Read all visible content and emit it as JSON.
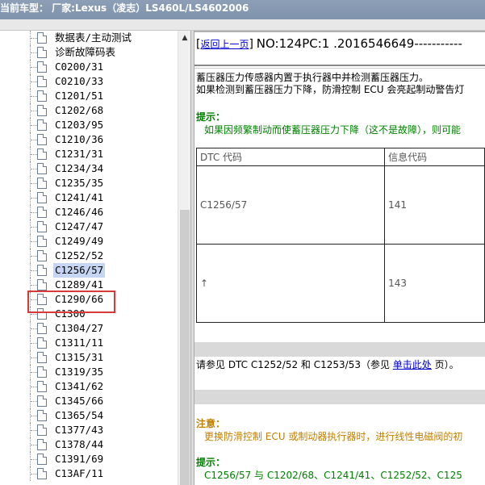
{
  "window": {
    "title": "当前车型：  厂家:Lexus（凌志）LS460L/LS4602006"
  },
  "tree": {
    "items": [
      {
        "label": "数据表/主动测试"
      },
      {
        "label": "诊断故障码表"
      },
      {
        "label": "C0200/31"
      },
      {
        "label": "C0210/33"
      },
      {
        "label": "C1201/51"
      },
      {
        "label": "C1202/68"
      },
      {
        "label": "C1203/95"
      },
      {
        "label": "C1210/36"
      },
      {
        "label": "C1231/31"
      },
      {
        "label": "C1234/34"
      },
      {
        "label": "C1235/35"
      },
      {
        "label": "C1241/41"
      },
      {
        "label": "C1246/46"
      },
      {
        "label": "C1247/47"
      },
      {
        "label": "C1249/49"
      },
      {
        "label": "C1252/52"
      },
      {
        "label": "C1256/57"
      },
      {
        "label": "C1289/41"
      },
      {
        "label": "C1290/66"
      },
      {
        "label": "C1300"
      },
      {
        "label": "C1304/27"
      },
      {
        "label": "C1311/11"
      },
      {
        "label": "C1315/31"
      },
      {
        "label": "C1319/35"
      },
      {
        "label": "C1341/62"
      },
      {
        "label": "C1345/66"
      },
      {
        "label": "C1365/54"
      },
      {
        "label": "C1377/43"
      },
      {
        "label": "C1378/44"
      },
      {
        "label": "C1391/69"
      },
      {
        "label": "C13AF/11"
      }
    ],
    "selected_index": 16,
    "scroll_up_glyph": "▲"
  },
  "content": {
    "back_link": "返回上一页",
    "open_bracket": "[",
    "close_bracket": "]",
    "doc_no": "NO:124PC:1 .2016546649-----------",
    "para1_line1": "蓄压器压力传感器内置于执行器中并检测蓄压器压力。",
    "para1_line2": "如果检测到蓄压器压力下降，防滑控制 ECU 会亮起制动警告灯",
    "hint1_title": "提示：",
    "hint1_text": "如果因频繁制动而使蓄压器压力下降（这不是故障），则可能",
    "table": {
      "headers": [
        "DTC 代码",
        "信息代码"
      ],
      "rows": [
        [
          "C1256/57",
          "141"
        ],
        [
          "↑",
          "143"
        ]
      ]
    },
    "ref_prefix": "请参见 DTC C1252/52 和 C1253/53（参见 ",
    "ref_link": "单击此处",
    "ref_suffix": " 页）。",
    "notice_title": "注意：",
    "notice_text": "更换防滑控制 ECU 或制动器执行器时，进行线性电磁阀的初",
    "hint2_title": "提示：",
    "hint2_text": "C1256/57 与 C1202/68、C1241/41、C1252/52、C125"
  },
  "colors": {
    "hint_green": "#008000",
    "notice_orange": "#c08000",
    "link_blue": "#0000cc",
    "selection_highlight": "#c6d6f2",
    "annotation_red": "#d83a3a"
  }
}
